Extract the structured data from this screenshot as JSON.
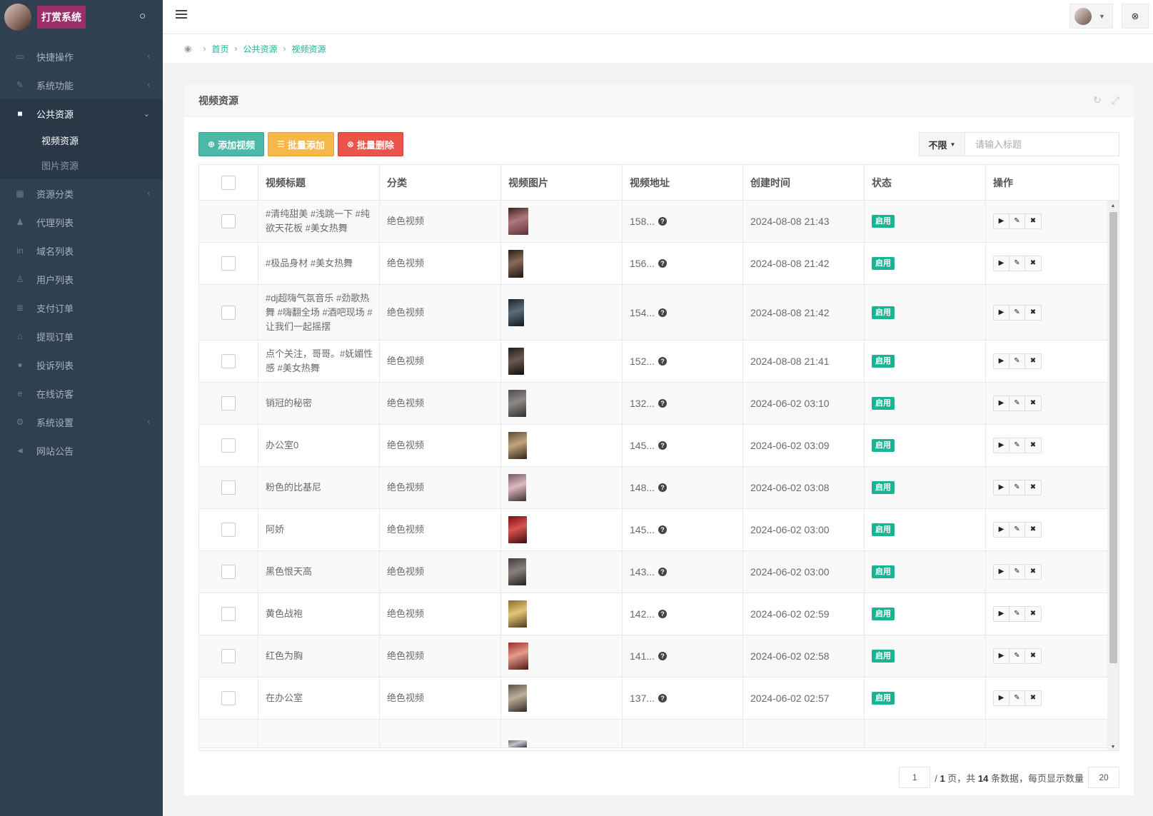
{
  "brand": {
    "logo_text": "打赏系统",
    "toggle_icon": "drop-icon"
  },
  "sidebar": {
    "items": [
      {
        "label": "快捷操作",
        "icon": "folder-icon",
        "glyph": "▭",
        "has_arrow": true
      },
      {
        "label": "系统功能",
        "icon": "wrench-icon",
        "glyph": "✎",
        "has_arrow": true
      },
      {
        "label": "公共资源",
        "icon": "video-camera-icon",
        "glyph": "■",
        "has_arrow": true,
        "expanded": true,
        "children": [
          {
            "label": "视频资源",
            "current": true
          },
          {
            "label": "图片资源"
          }
        ]
      },
      {
        "label": "资源分类",
        "icon": "grid-icon",
        "glyph": "▦",
        "has_arrow": true
      },
      {
        "label": "代理列表",
        "icon": "users-icon",
        "glyph": "♟",
        "has_arrow": false
      },
      {
        "label": "域名列表",
        "icon": "linkedin-icon",
        "glyph": "in",
        "has_arrow": false
      },
      {
        "label": "用户列表",
        "icon": "user-icon",
        "glyph": "♙",
        "has_arrow": false
      },
      {
        "label": "支付订单",
        "icon": "database-icon",
        "glyph": "≣",
        "has_arrow": false
      },
      {
        "label": "提现订单",
        "icon": "bank-icon",
        "glyph": "⌂",
        "has_arrow": false
      },
      {
        "label": "投诉列表",
        "icon": "exclamation-circle-icon",
        "glyph": "●",
        "has_arrow": false
      },
      {
        "label": "在线访客",
        "icon": "ie-icon",
        "glyph": "e",
        "has_arrow": false
      },
      {
        "label": "系统设置",
        "icon": "gear-icon",
        "glyph": "⚙",
        "has_arrow": true
      },
      {
        "label": "网站公告",
        "icon": "bullhorn-icon",
        "glyph": "◄",
        "has_arrow": false
      }
    ]
  },
  "topbar": {
    "menu_icon": "hamburger-icon",
    "user_icon": "avatar",
    "trash_icon": "trash-icon"
  },
  "breadcrumb": {
    "items": [
      "首页",
      "公共资源",
      "视频资源"
    ]
  },
  "panel": {
    "title": "视频资源",
    "toolbar": {
      "add_label": "添加视频",
      "batch_add_label": "批量添加",
      "batch_delete_label": "批量删除"
    },
    "search": {
      "filter_value": "不限",
      "placeholder": "请输入标题"
    },
    "table": {
      "columns": [
        "",
        "视频标题",
        "分类",
        "视频图片",
        "视频地址",
        "创建时间",
        "状态",
        "操作"
      ],
      "rows": [
        {
          "title": "#清纯甜美 #浅跳一下 #纯欲天花板 #美女热舞",
          "category": "绝色视频",
          "url": "158...",
          "time": "2024-08-08 21:43",
          "status": "启用",
          "thumb": [
            "#3a2020",
            "#b0787c",
            "#5c3138"
          ],
          "tw": 28,
          "th": 38
        },
        {
          "title": "#极品身材 #美女热舞",
          "category": "绝色视频",
          "url": "156...",
          "time": "2024-08-08 21:42",
          "status": "启用",
          "thumb": [
            "#2a1d18",
            "#8a6a58",
            "#1b1411"
          ],
          "tw": 21,
          "th": 39
        },
        {
          "title": "#dj超嗨气氛音乐 #劲歌热舞 #嗨翻全场 #酒吧现场 #让我们一起摇摆",
          "category": "绝色视频",
          "url": "154...",
          "time": "2024-08-08 21:42",
          "status": "启用",
          "thumb": [
            "#1c242c",
            "#5b6d78",
            "#12181d"
          ],
          "tw": 22,
          "th": 38
        },
        {
          "title": "点个关注，哥哥。#妩媚性感 #美女热舞",
          "category": "绝色视频",
          "url": "152...",
          "time": "2024-08-08 21:41",
          "status": "启用",
          "thumb": [
            "#1a1a1a",
            "#6c5a52",
            "#0e0e0e"
          ],
          "tw": 22,
          "th": 38
        },
        {
          "title": "销冠的秘密",
          "category": "绝色视频",
          "url": "132...",
          "time": "2024-06-02 03:10",
          "status": "启用",
          "thumb": [
            "#4d4b4c",
            "#8f8a88",
            "#2e2d2e"
          ],
          "tw": 25,
          "th": 38
        },
        {
          "title": "办公室0",
          "category": "绝色视频",
          "url": "145...",
          "time": "2024-06-02 03:09",
          "status": "启用",
          "thumb": [
            "#5a4a32",
            "#c2a47c",
            "#2e261b"
          ],
          "tw": 26,
          "th": 38
        },
        {
          "title": "粉色的比基尼",
          "category": "绝色视频",
          "url": "148...",
          "time": "2024-06-02 03:08",
          "status": "启用",
          "thumb": [
            "#6e5a5e",
            "#e0b8c0",
            "#3a2f31"
          ],
          "tw": 25,
          "th": 38
        },
        {
          "title": "阿娇",
          "category": "绝色视频",
          "url": "145...",
          "time": "2024-06-02 03:00",
          "status": "启用",
          "thumb": [
            "#7a1010",
            "#d9534f",
            "#3b0b0b"
          ],
          "tw": 26,
          "th": 38
        },
        {
          "title": "黑色恨天高",
          "category": "绝色视频",
          "url": "143...",
          "time": "2024-06-02 03:00",
          "status": "启用",
          "thumb": [
            "#3e3b3a",
            "#8a817d",
            "#232120"
          ],
          "tw": 25,
          "th": 38
        },
        {
          "title": "黄色战袍",
          "category": "绝色视频",
          "url": "142...",
          "time": "2024-06-02 02:59",
          "status": "启用",
          "thumb": [
            "#8a6a2a",
            "#e6c57a",
            "#4d3a16"
          ],
          "tw": 26,
          "th": 38
        },
        {
          "title": "红色为胸",
          "category": "绝色视频",
          "url": "141...",
          "time": "2024-06-02 02:58",
          "status": "启用",
          "thumb": [
            "#9c2b2b",
            "#e59c8a",
            "#4f1515"
          ],
          "tw": 28,
          "th": 38
        },
        {
          "title": "在办公室",
          "category": "绝色视频",
          "url": "137...",
          "time": "2024-06-02 02:57",
          "status": "启用",
          "thumb": [
            "#5b5148",
            "#bfae9c",
            "#2e2924"
          ],
          "tw": 26,
          "th": 38
        },
        {
          "title": "",
          "category": "",
          "url": "",
          "time": "",
          "status": "",
          "thumb": [
            "#6a7078",
            "#c2c6cc",
            "#3a3e44"
          ],
          "tw": 26,
          "th": 10,
          "partial": true
        }
      ],
      "actions": [
        "play-icon",
        "edit-icon",
        "delete-icon"
      ]
    },
    "pagination": {
      "current_page": "1",
      "total_pages": "1",
      "total_count": "14",
      "page_size": "20",
      "text_pages_prefix": "/ ",
      "text_pages_suffix": " 页，共 ",
      "text_count_suffix": " 条数据，每页显示数量"
    }
  },
  "colors": {
    "sidebar": "#2f4050",
    "primary": "#1ab394",
    "teal_btn": "#4cb8a8",
    "orange_btn": "#f6b84a",
    "red_btn": "#e9544b"
  }
}
